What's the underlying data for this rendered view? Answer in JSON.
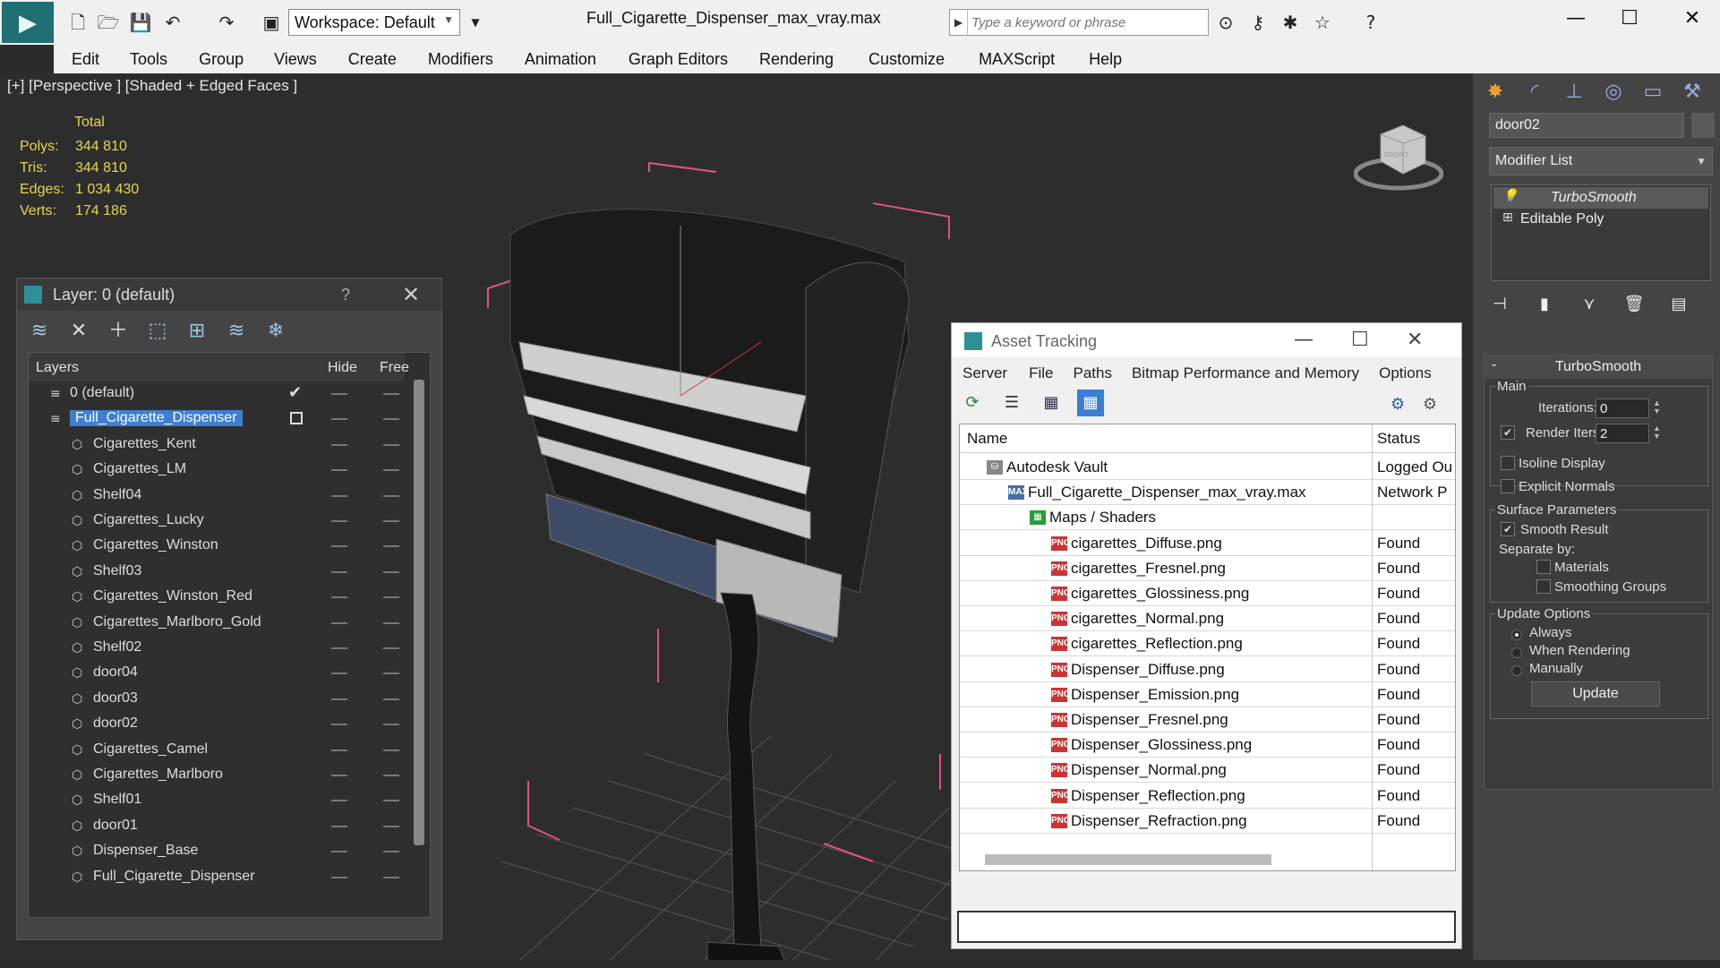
{
  "titlebar": {
    "workspace": "Workspace: Default",
    "document_title": "Full_Cigarette_Dispenser_max_vray.max",
    "search_placeholder": "Type a keyword or phrase"
  },
  "menubar": [
    "Edit",
    "Tools",
    "Group",
    "Views",
    "Create",
    "Modifiers",
    "Animation",
    "Graph Editors",
    "Rendering",
    "Customize",
    "MAXScript",
    "Help"
  ],
  "viewport": {
    "label": "[+] [Perspective ] [Shaded + Edged Faces ]",
    "stats_header": "Total",
    "stats": [
      {
        "label": "Polys:",
        "value": "344 810"
      },
      {
        "label": "Tris:",
        "value": "344 810"
      },
      {
        "label": "Edges:",
        "value": "1 034 430"
      },
      {
        "label": "Verts:",
        "value": "174 186"
      }
    ],
    "viewcube_front": "FRONT"
  },
  "layer_panel": {
    "title": "Layer: 0 (default)",
    "help": "?",
    "columns": {
      "layers": "Layers",
      "hide": "Hide",
      "freeze": "Free"
    },
    "rows": [
      {
        "name": "0 (default)",
        "level": 0,
        "type": "layer",
        "current": true
      },
      {
        "name": "Full_Cigarette_Dispenser",
        "level": 0,
        "type": "layer",
        "selected": true
      },
      {
        "name": "Cigarettes_Kent",
        "level": 1,
        "type": "object"
      },
      {
        "name": "Cigarettes_LM",
        "level": 1,
        "type": "object"
      },
      {
        "name": "Shelf04",
        "level": 1,
        "type": "object"
      },
      {
        "name": "Cigarettes_Lucky",
        "level": 1,
        "type": "object"
      },
      {
        "name": "Cigarettes_Winston",
        "level": 1,
        "type": "object"
      },
      {
        "name": "Shelf03",
        "level": 1,
        "type": "object"
      },
      {
        "name": "Cigarettes_Winston_Red",
        "level": 1,
        "type": "object"
      },
      {
        "name": "Cigarettes_Marlboro_Gold",
        "level": 1,
        "type": "object"
      },
      {
        "name": "Shelf02",
        "level": 1,
        "type": "object"
      },
      {
        "name": "door04",
        "level": 1,
        "type": "object"
      },
      {
        "name": "door03",
        "level": 1,
        "type": "object"
      },
      {
        "name": "door02",
        "level": 1,
        "type": "object"
      },
      {
        "name": "Cigarettes_Camel",
        "level": 1,
        "type": "object"
      },
      {
        "name": "Cigarettes_Marlboro",
        "level": 1,
        "type": "object"
      },
      {
        "name": "Shelf01",
        "level": 1,
        "type": "object"
      },
      {
        "name": "door01",
        "level": 1,
        "type": "object"
      },
      {
        "name": "Dispenser_Base",
        "level": 1,
        "type": "object"
      },
      {
        "name": "Full_Cigarette_Dispenser",
        "level": 1,
        "type": "object"
      }
    ]
  },
  "asset_tracking": {
    "title": "Asset Tracking",
    "menu": [
      "Server",
      "File",
      "Paths",
      "Bitmap Performance and Memory",
      "Options"
    ],
    "columns": {
      "name": "Name",
      "status": "Status"
    },
    "rows": [
      {
        "name": "Autodesk Vault",
        "status": "Logged Ou",
        "indent": 0,
        "icon": "vault"
      },
      {
        "name": "Full_Cigarette_Dispenser_max_vray.max",
        "status": "Network P",
        "indent": 1,
        "icon": "max"
      },
      {
        "name": "Maps / Shaders",
        "status": "",
        "indent": 2,
        "icon": "maps"
      },
      {
        "name": "cigarettes_Diffuse.png",
        "status": "Found",
        "indent": 3,
        "icon": "png"
      },
      {
        "name": "cigarettes_Fresnel.png",
        "status": "Found",
        "indent": 3,
        "icon": "png"
      },
      {
        "name": "cigarettes_Glossiness.png",
        "status": "Found",
        "indent": 3,
        "icon": "png"
      },
      {
        "name": "cigarettes_Normal.png",
        "status": "Found",
        "indent": 3,
        "icon": "png"
      },
      {
        "name": "cigarettes_Reflection.png",
        "status": "Found",
        "indent": 3,
        "icon": "png"
      },
      {
        "name": "Dispenser_Diffuse.png",
        "status": "Found",
        "indent": 3,
        "icon": "png"
      },
      {
        "name": "Dispenser_Emission.png",
        "status": "Found",
        "indent": 3,
        "icon": "png"
      },
      {
        "name": "Dispenser_Fresnel.png",
        "status": "Found",
        "indent": 3,
        "icon": "png"
      },
      {
        "name": "Dispenser_Glossiness.png",
        "status": "Found",
        "indent": 3,
        "icon": "png"
      },
      {
        "name": "Dispenser_Normal.png",
        "status": "Found",
        "indent": 3,
        "icon": "png"
      },
      {
        "name": "Dispenser_Reflection.png",
        "status": "Found",
        "indent": 3,
        "icon": "png"
      },
      {
        "name": "Dispenser_Refraction.png",
        "status": "Found",
        "indent": 3,
        "icon": "png"
      }
    ],
    "png_icon_text": "PNG"
  },
  "command_panel": {
    "object_name": "door02",
    "modifier_list": "Modifier List",
    "stack": [
      {
        "name": "TurboSmooth",
        "selected": true
      },
      {
        "name": "Editable Poly",
        "selected": false
      }
    ],
    "turbosmooth": {
      "title": "TurboSmooth",
      "main_label": "Main",
      "iterations_label": "Iterations:",
      "iterations_value": "0",
      "render_iters_label": "Render Iters:",
      "render_iters_value": "2",
      "render_iters_checked": true,
      "isoline_label": "Isoline Display",
      "explicit_normals_label": "Explicit Normals",
      "surface_params_label": "Surface Parameters",
      "smooth_result_label": "Smooth Result",
      "smooth_result_checked": true,
      "separate_by_label": "Separate by:",
      "materials_label": "Materials",
      "smoothing_groups_label": "Smoothing Groups",
      "update_options_label": "Update Options",
      "always_label": "Always",
      "when_rendering_label": "When Rendering",
      "manually_label": "Manually",
      "update_button": "Update"
    }
  },
  "colors": {
    "viewport_bg": "#2d2d2d",
    "stats_yellow": "#e8d44d",
    "selection_blue": "#3f7fd2",
    "bbox_pink": "#e0508a",
    "png_red": "#cc3333"
  }
}
